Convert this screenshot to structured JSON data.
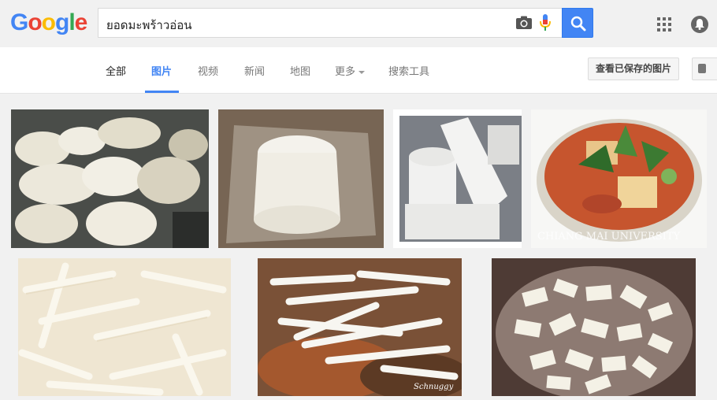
{
  "header": {
    "logo_letters": [
      {
        "ch": "G",
        "color": "#4285F4"
      },
      {
        "ch": "o",
        "color": "#EA4335"
      },
      {
        "ch": "o",
        "color": "#FBBC05"
      },
      {
        "ch": "g",
        "color": "#4285F4"
      },
      {
        "ch": "l",
        "color": "#34A853"
      },
      {
        "ch": "e",
        "color": "#EA4335"
      }
    ],
    "search_query": "ยอดมะพร้าวอ่อน",
    "icons": [
      "camera-icon",
      "mic-icon",
      "search-icon",
      "apps-icon",
      "notifications-icon"
    ]
  },
  "nav": {
    "tabs": [
      {
        "label": "全部",
        "state": "normal-dark"
      },
      {
        "label": "图片",
        "state": "active"
      },
      {
        "label": "视频",
        "state": "normal"
      },
      {
        "label": "新闻",
        "state": "normal"
      },
      {
        "label": "地图",
        "state": "normal"
      },
      {
        "label": "更多",
        "state": "dropdown"
      },
      {
        "label": "搜索工具",
        "state": "normal"
      }
    ],
    "saved_images_button": "查看已保存的图片"
  },
  "results": {
    "watermarks": [
      "CHIANG MAI UNIVERSITY",
      "Schnuggy"
    ]
  },
  "colors": {
    "accent": "#4285f4",
    "background": "#f1f1f1"
  }
}
